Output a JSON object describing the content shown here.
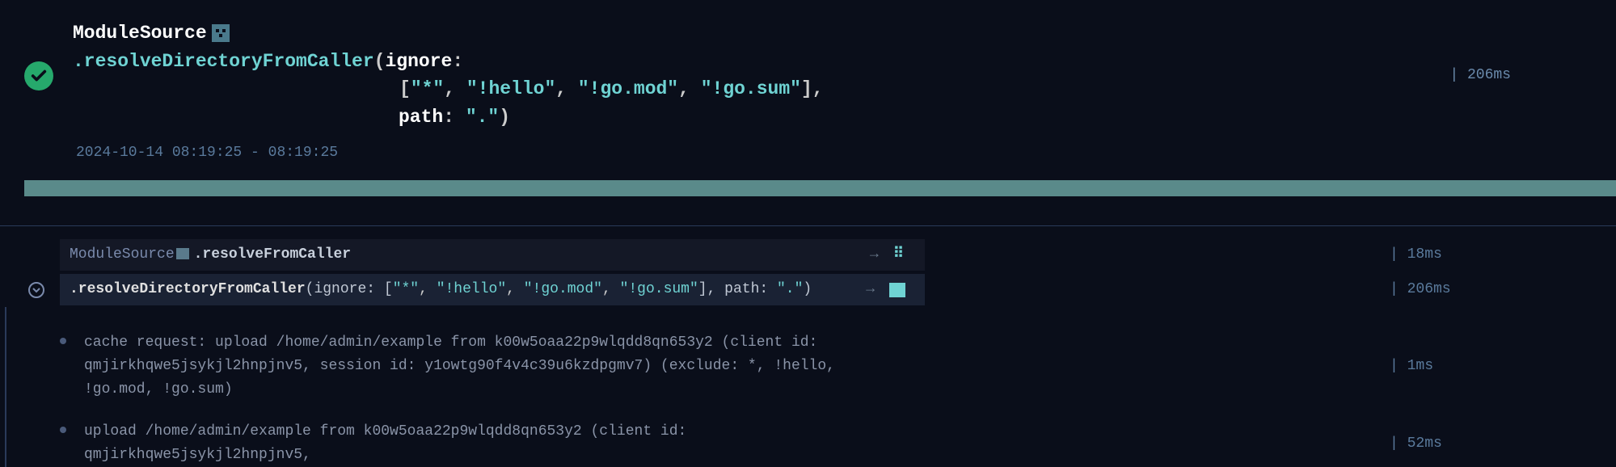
{
  "header": {
    "module": "ModuleSource",
    "method": ".resolveDirectoryFromCaller",
    "param_ignore": "ignore",
    "ignore_vals": [
      "\"*\"",
      "\"!hello\"",
      "\"!go.mod\"",
      "\"!go.sum\""
    ],
    "param_path": "path",
    "path_val": "\".\"",
    "timestamp": "2024-10-14 08:19:25 - 08:19:25",
    "duration": "| 206ms"
  },
  "trace": {
    "row1": {
      "module": "ModuleSource",
      "method": ".resolveFromCaller",
      "duration": "| 18ms"
    },
    "row2": {
      "prefix": ".resolveDirectoryFromCaller",
      "open": "(ignore: [",
      "vals": [
        "\"*\"",
        "\"!hello\"",
        "\"!go.mod\"",
        "\"!go.sum\""
      ],
      "close": "], path: ",
      "path": "\".\"",
      "end": ")",
      "duration": "| 206ms"
    }
  },
  "logs": {
    "line1": "cache request: upload /home/admin/example from k00w5oaa22p9wlqdd8qn653y2 (client id: qmjirkhqwe5jsykjl2hnpjnv5, session id: y1owtg90f4v4c39u6kzdpgmv7) (exclude: *, !hello, !go.mod, !go.sum)",
    "duration1": "| 1ms",
    "line2": "upload /home/admin/example from k00w5oaa22p9wlqdd8qn653y2 (client id: qmjirkhqwe5jsykjl2hnpjnv5,",
    "duration2": "| 52ms"
  }
}
